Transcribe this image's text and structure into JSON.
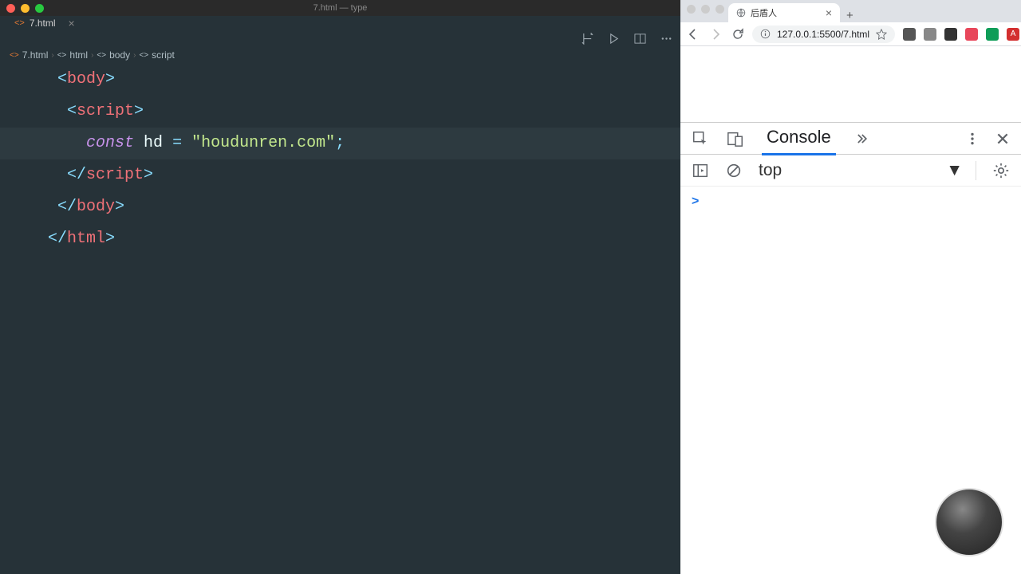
{
  "editor": {
    "window_title": "7.html — type",
    "tab": {
      "icon": "<>",
      "label": "7.html"
    },
    "breadcrumb": {
      "file_icon": "<>",
      "file": "7.html",
      "html_icon": "<>",
      "html": "html",
      "body_icon": "<>",
      "body": "body",
      "script_icon": "<>",
      "script": "script"
    },
    "code": {
      "body_open_partial": "body",
      "script_open": "script",
      "const_kw": "const",
      "var_name": "hd",
      "eq": "=",
      "string": "\"houdunren.com\"",
      "semi": ";",
      "script_close": "script",
      "body_close": "body",
      "html_close": "html"
    }
  },
  "browser": {
    "tab_title": "后盾人",
    "url": "127.0.0.1:5500/7.html",
    "devtools": {
      "tab_console": "Console",
      "context": "top",
      "prompt": ">"
    }
  }
}
